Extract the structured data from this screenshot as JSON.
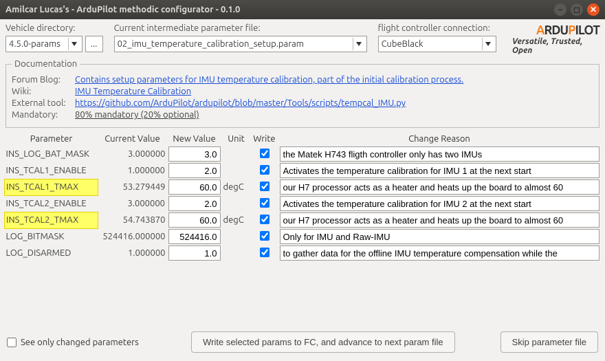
{
  "window": {
    "title": "Amilcar Lucas's - ArduPilot methodic configurator - 0.1.0"
  },
  "top": {
    "vehicle_dir_label": "Vehicle directory:",
    "vehicle_dir_value": "4.5.0-params",
    "browse_btn": "...",
    "param_file_label": "Current intermediate parameter file:",
    "param_file_value": "02_imu_temperature_calibration_setup.param",
    "conn_label": "flight controller connection:",
    "conn_value": "CubeBlack",
    "logo_sub": "Versatile, Trusted, Open"
  },
  "docs": {
    "legend": "Documentation",
    "blog_label": "Forum Blog:",
    "blog_link": "Contains setup parameters for IMU temperature calibration, part of the initial calibration process.",
    "wiki_label": "Wiki:",
    "wiki_link": "IMU Temperature Calibration",
    "ext_label": "External tool:",
    "ext_link": "https://github.com/ArduPilot/ardupilot/blob/master/Tools/scripts/tempcal_IMU.py",
    "mand_label": "Mandatory:",
    "mand_text": "80% mandatory (20% optional)"
  },
  "headers": {
    "parameter": "Parameter",
    "current": "Current Value",
    "newv": "New Value",
    "unit": "Unit",
    "write": "Write",
    "reason": "Change Reason"
  },
  "rows": [
    {
      "param": "INS_LOG_BAT_MASK",
      "hl": false,
      "curr": "3.000000",
      "newv": "3.0",
      "unit": "",
      "reason": "the Matek H743 fligth controller only has two IMUs"
    },
    {
      "param": "INS_TCAL1_ENABLE",
      "hl": false,
      "curr": "1.000000",
      "newv": "2.0",
      "unit": "",
      "reason": "Activates the temperature calibration for IMU 1 at the next start"
    },
    {
      "param": "INS_TCAL1_TMAX",
      "hl": true,
      "curr": "53.279449",
      "newv": "60.0",
      "unit": "degC",
      "reason": "our H7 processor acts as a heater and heats up the board to almost 60"
    },
    {
      "param": "INS_TCAL2_ENABLE",
      "hl": false,
      "curr": "3.000000",
      "newv": "2.0",
      "unit": "",
      "reason": "Activates the temperature calibration for IMU 2 at the next start"
    },
    {
      "param": "INS_TCAL2_TMAX",
      "hl": true,
      "curr": "54.743870",
      "newv": "60.0",
      "unit": "degC",
      "reason": "our H7 processor acts as a heater and heats up the board to almost 60"
    },
    {
      "param": "LOG_BITMASK",
      "hl": false,
      "curr": "524416.000000",
      "newv": "524416.0",
      "unit": "",
      "reason": "Only for IMU and Raw-IMU"
    },
    {
      "param": "LOG_DISARMED",
      "hl": false,
      "curr": "1.000000",
      "newv": "1.0",
      "unit": "",
      "reason": "to gather data for the offline IMU temperature compensation while the"
    }
  ],
  "bottom": {
    "only_changed": "See only changed parameters",
    "write_btn": "Write selected params to FC, and advance to next param file",
    "skip_btn": "Skip parameter file"
  }
}
